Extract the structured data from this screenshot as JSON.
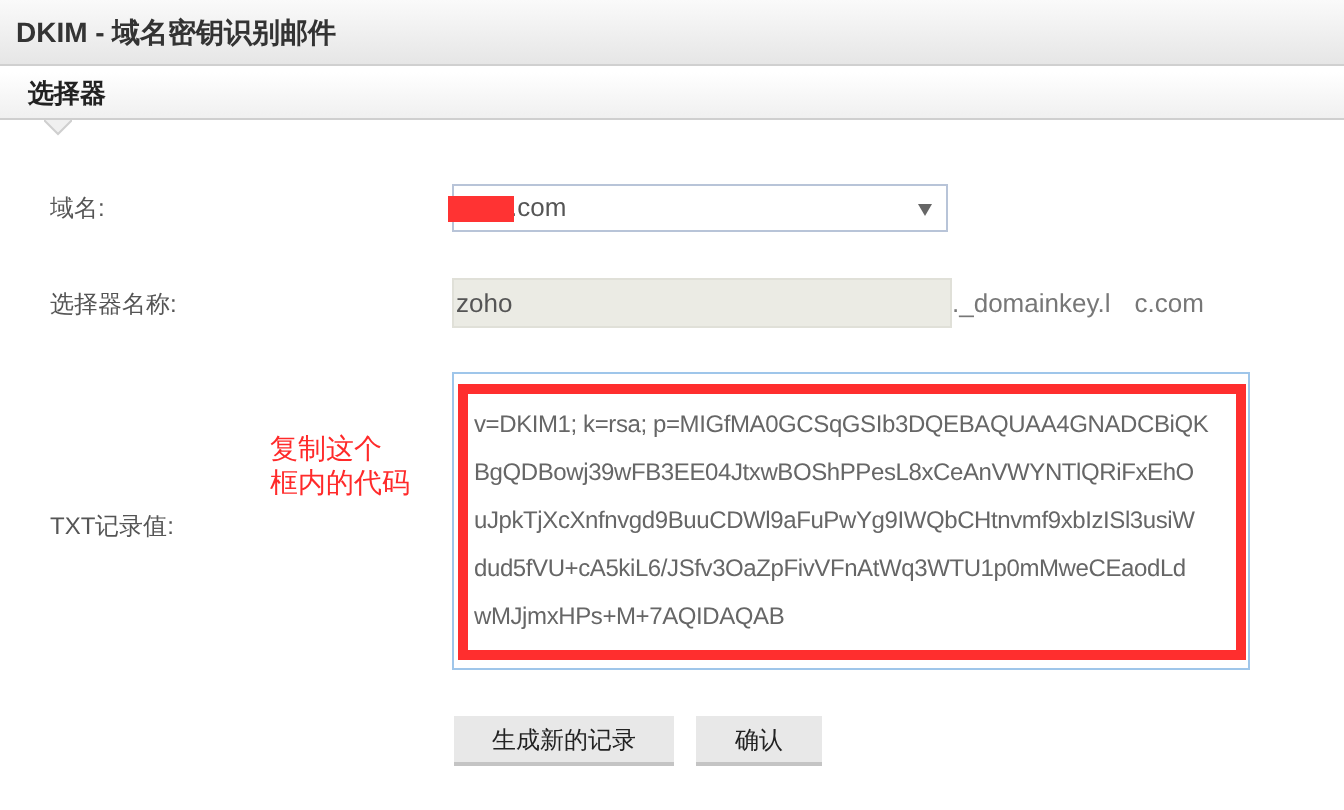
{
  "window": {
    "title": "DKIM - 域名密钥识别邮件"
  },
  "tabs": [
    {
      "label": "选择器",
      "selected": true
    }
  ],
  "form": {
    "domain": {
      "label": "域名:",
      "value": ".com"
    },
    "selector": {
      "label": "选择器名称:",
      "value": "zoho",
      "suffix_parts": [
        "._domainkey.l",
        "c.com"
      ]
    },
    "txt": {
      "label": "TXT记录值:",
      "lines": [
        "v=DKIM1; k=rsa; p=MIGfMA0GCSqGSIb3DQEBAQUAA4GNADCBiQK",
        "BgQDBowj39wFB3EE04JtxwBOShPPesL8xCeAnVWYNTlQRiFxEhO",
        "uJpkTjXcXnfnvgd9BuuCDWl9aFuPwYg9IWQbCHtnvmf9xbIzISl3usiW",
        "dud5fVU+cA5kiL6/JSfv3OaZpFivVFnAtWq3WTU1p0mMweCEaodLd",
        "wMJjmxHPs+M+7AQIDAQAB"
      ]
    }
  },
  "annotation": {
    "lines": [
      "复制这个",
      "框内的代码"
    ]
  },
  "buttons": [
    "生成新的记录",
    "确认"
  ]
}
